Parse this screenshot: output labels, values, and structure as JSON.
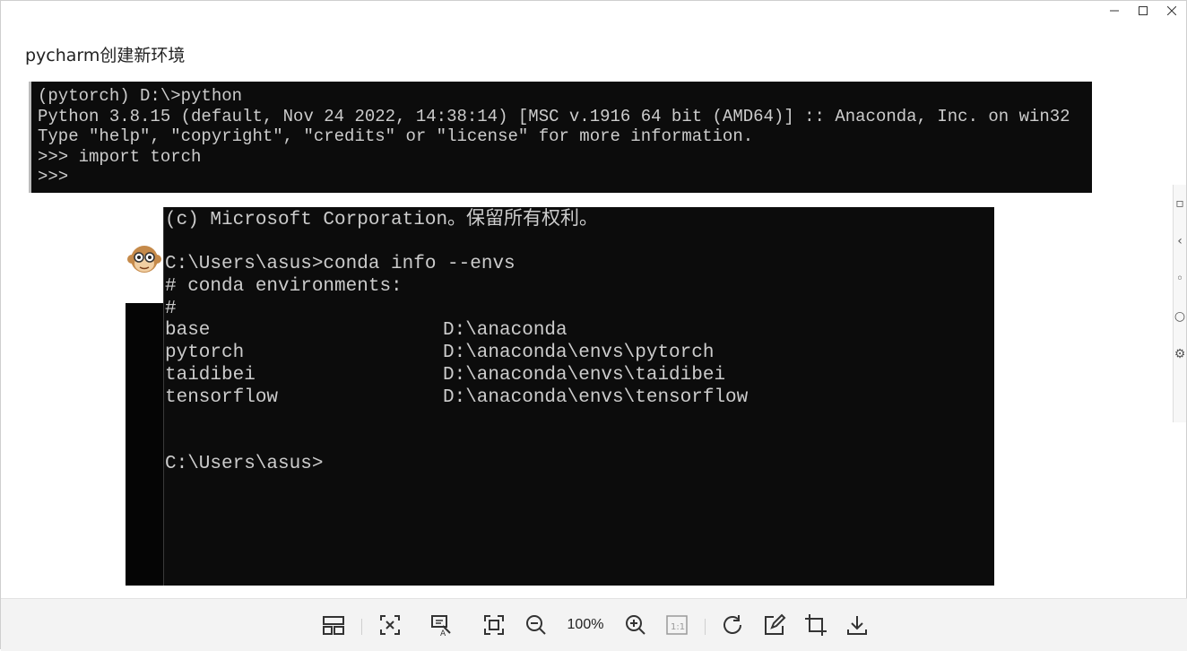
{
  "window": {
    "title": "pycharm创建新环境",
    "controls": {
      "minimize": "—",
      "maximize": "☐",
      "close": "✕"
    }
  },
  "terminal_top": {
    "lines": [
      "(pytorch) D:\\>python",
      "Python 3.8.15 (default, Nov 24 2022, 14:38:14) [MSC v.1916 64 bit (AMD64)] :: Anaconda, Inc. on win32",
      "Type \"help\", \"copyright\", \"credits\" or \"license\" for more information.",
      ">>> import torch",
      ">>>"
    ]
  },
  "terminal_main": {
    "copyright": "(c) Microsoft Corporation。保留所有权利。",
    "command": "C:\\Users\\asus>conda info --envs",
    "header": "# conda environments:",
    "hash": "#",
    "envs": [
      {
        "name": "base",
        "path": "D:\\anaconda"
      },
      {
        "name": "pytorch",
        "path": "D:\\anaconda\\envs\\pytorch"
      },
      {
        "name": "taidibei",
        "path": "D:\\anaconda\\envs\\taidibei"
      },
      {
        "name": "tensorflow",
        "path": "D:\\anaconda\\envs\\tensorflow"
      }
    ],
    "prompt": "C:\\Users\\asus>"
  },
  "toolbar": {
    "zoom_level": "100%",
    "actual_size_label": "1:1"
  },
  "colors": {
    "terminal_bg": "#0c0c0c",
    "terminal_fg": "#cccccc",
    "toolbar_bg": "#f3f3f3"
  }
}
